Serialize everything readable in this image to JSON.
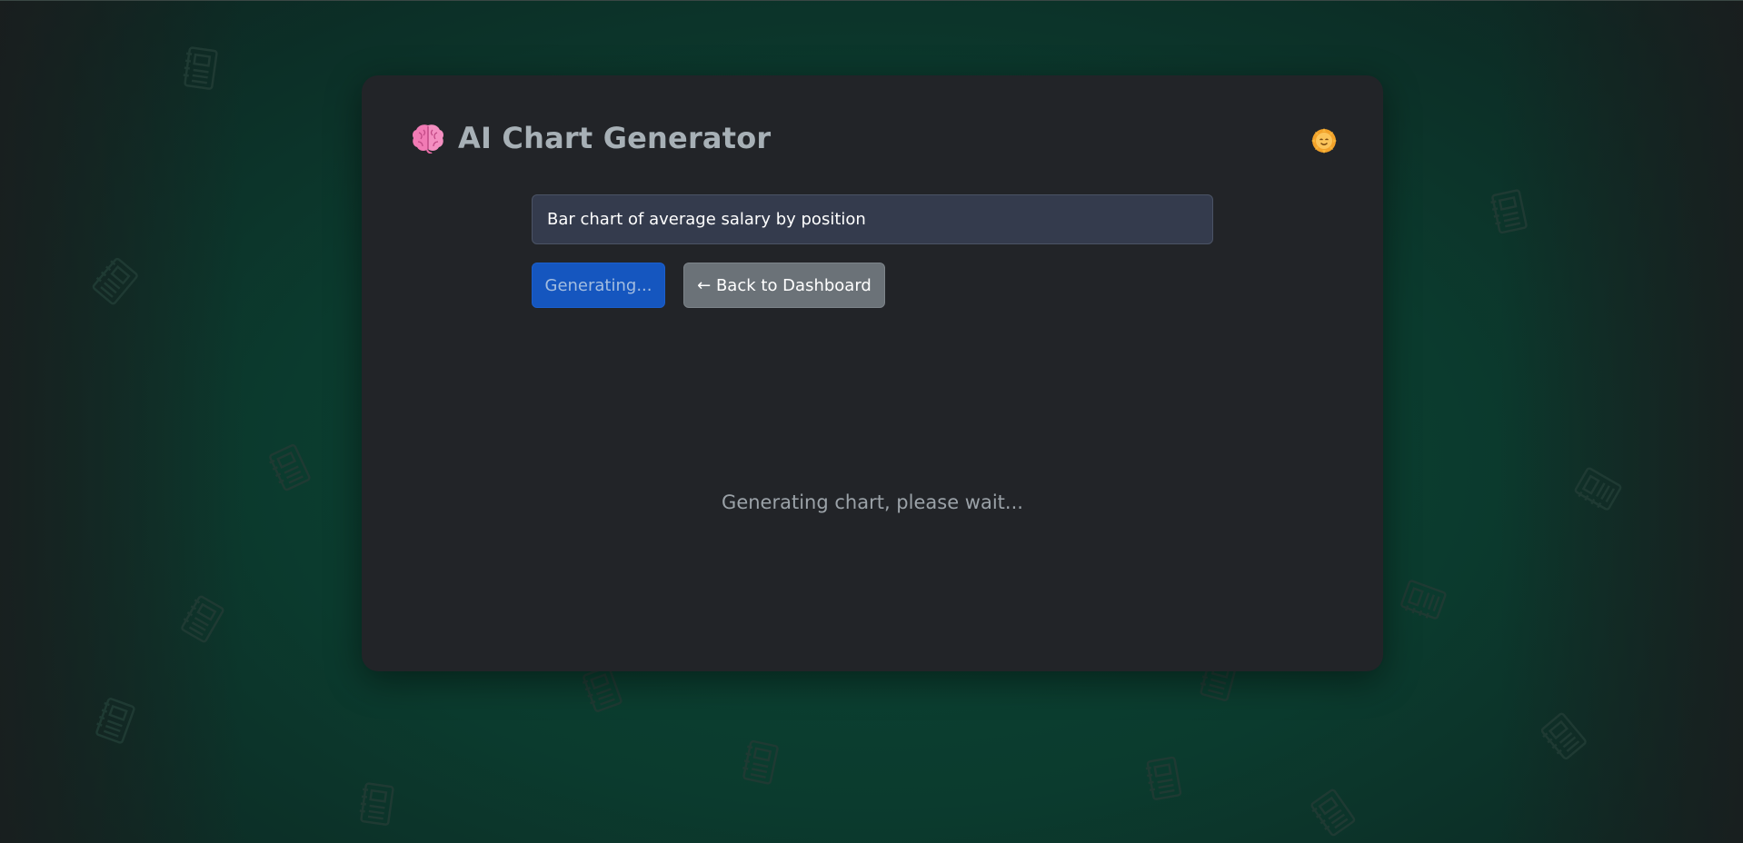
{
  "app": {
    "title": "AI Chart Generator",
    "logo_icon": "brain-icon",
    "theme_toggle_icon": "sun-face-icon"
  },
  "prompt": {
    "value": "Bar chart of average salary by position",
    "placeholder": ""
  },
  "actions": {
    "generate_label": "Generating...",
    "back_label": "← Back to Dashboard"
  },
  "status": {
    "message": "Generating chart, please wait..."
  },
  "colors": {
    "background_accent": "#0b3b2e",
    "card": "#222428",
    "input_bg": "#343b4d",
    "primary": "#1556bf",
    "secondary": "#6b7278",
    "title_text": "#a7b0b6",
    "status_text": "#9ba2a8"
  },
  "background": {
    "pattern_icon": "notebook-icon"
  }
}
